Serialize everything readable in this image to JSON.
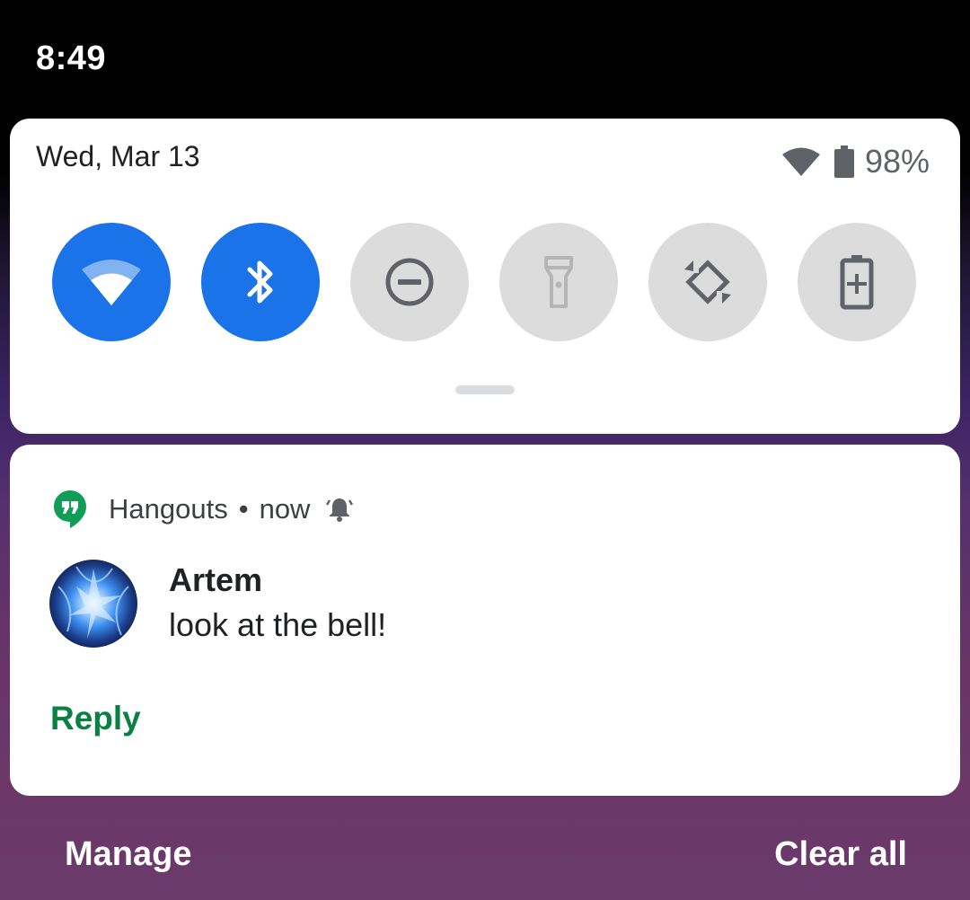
{
  "status_bar": {
    "time": "8:49"
  },
  "quick_settings": {
    "date": "Wed, Mar 13",
    "battery_percent": "98%",
    "tiles": [
      {
        "name": "wifi",
        "state": "on"
      },
      {
        "name": "bluetooth",
        "state": "on"
      },
      {
        "name": "do-not-disturb",
        "state": "off"
      },
      {
        "name": "flashlight",
        "state": "unavailable"
      },
      {
        "name": "auto-rotate",
        "state": "off"
      },
      {
        "name": "battery-saver",
        "state": "off"
      }
    ]
  },
  "notification": {
    "app_name": "Hangouts",
    "separator": "•",
    "time": "now",
    "sender": "Artem",
    "message": "look at the bell!",
    "action_label": "Reply"
  },
  "footer": {
    "manage_label": "Manage",
    "clear_all_label": "Clear all"
  },
  "colors": {
    "tile_on": "#1a73e8",
    "tile_off": "#dcdcdc",
    "hangouts_green": "#0f9d58",
    "reply_green": "#0b8043"
  }
}
